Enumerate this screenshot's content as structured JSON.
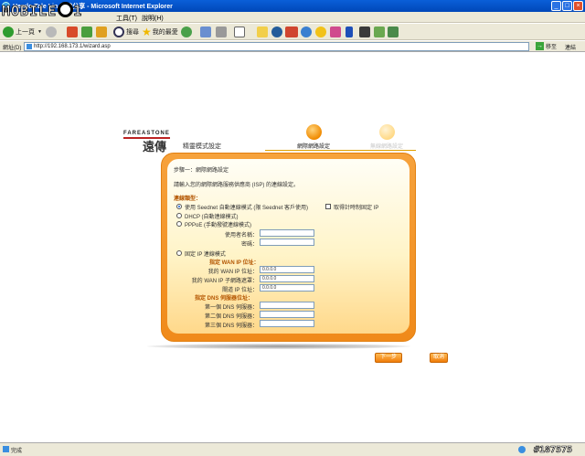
{
  "window": {
    "title": "Hemlo Tale Lin 無線分享 - Microsoft Internet Explorer",
    "watermark": "MOBILE01",
    "corner_mark": "#187575"
  },
  "menu": {
    "tools": "工具(T)",
    "help": "說明(H)"
  },
  "toolbar": {
    "back": "上一頁",
    "search": "搜尋",
    "favorites": "我的最愛"
  },
  "address": {
    "label": "網址(D)",
    "url": "http://192.168.173.1/wizard.asp",
    "go": "移至",
    "links": "連結"
  },
  "brand": {
    "en": "FAREASTONE",
    "cn": "遠傳"
  },
  "wizard": {
    "title": "精靈模式設定",
    "step1": "網際網路設定",
    "step2": "無線網路設定"
  },
  "form": {
    "step_heading": "步驟一：網際網路設定",
    "intro": "請輸入您的網際網路服務供應商 (ISP) 的連線設定。",
    "conn_type_label": "連線類型：",
    "opt_seednet": "使用 Seednet 自動連線模式 (限 Seednet 客戶使用)",
    "opt_seednet_extra": "取得計時制固定 IP",
    "opt_dhcp": "DHCP (自動連線模式)",
    "opt_pppoe": "PPPoE (手動撥號連線模式)",
    "username_label": "使用者名稱：",
    "password_label": "密碼：",
    "opt_static": "固定 IP 連線模式",
    "wan_heading": "指定 WAN IP 位址：",
    "wan_ip_label": "我的 WAN IP 位址：",
    "wan_ip_value": "0.0.0.0",
    "subnet_label": "我的 WAN IP 子網路遮罩：",
    "subnet_value": "0.0.0.0",
    "gateway_label": "閘道 IP 位址：",
    "gateway_value": "0.0.0.0",
    "dns_heading": "指定 DNS 伺服器位址：",
    "dns1_label": "第一個 DNS 伺服器：",
    "dns2_label": "第二個 DNS 伺服器：",
    "dns3_label": "第三個 DNS 伺服器："
  },
  "buttons": {
    "next": "下一步",
    "cancel": "取消"
  },
  "status": {
    "text": "完成"
  }
}
